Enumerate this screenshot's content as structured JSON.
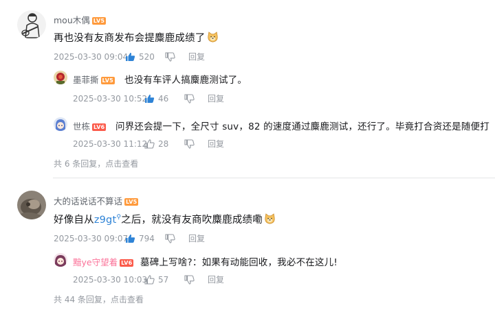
{
  "comments": [
    {
      "user": "mou木偶",
      "level": "LV5",
      "text": "再也没有友商发布会提麋鹿成绩了",
      "emoji": "doge-emoji",
      "time": "2025-03-30 09:04",
      "likes": "520",
      "reply_label": "回复",
      "replies": [
        {
          "user": "墨菲撕",
          "level": "LV5",
          "text": "也没有车评人搞麋鹿测试了。",
          "time": "2025-03-30 10:52",
          "likes": "46",
          "reply_label": "回复"
        },
        {
          "user": "世栋",
          "level": "LV6",
          "text": "问界还会提一下，全尺寸 suv，82 的速度通过麋鹿测试，还行了。毕竟打合资还是随便打",
          "time": "2025-03-30 11:12",
          "likes": "28",
          "reply_label": "回复"
        }
      ],
      "more_replies": "共 6 条回复，点击查看"
    },
    {
      "user": "大的话说话不算话",
      "level": "LV5",
      "text_before": "好像自从",
      "link_text": "z9gt",
      "text_after": "之后，就没有友商吹麋鹿成绩嘞",
      "emoji": "doge-emoji",
      "time": "2025-03-30 09:07",
      "likes": "794",
      "reply_label": "回复",
      "replies": [
        {
          "user": "黯ye守望着",
          "level": "LV6",
          "text": "墓碑上写啥?：如果有动能回收，我必不在这儿!",
          "time": "2025-03-30 10:03",
          "likes": "57",
          "reply_label": "回复"
        }
      ],
      "more_replies": "共 44 条回复，点击查看"
    }
  ],
  "colors": {
    "text": "#18191c",
    "meta": "#9499a0",
    "link": "#2e83d6",
    "level5": "#ff9a3c",
    "level6": "#fb5a4a",
    "vip_name": "#fb7299"
  }
}
